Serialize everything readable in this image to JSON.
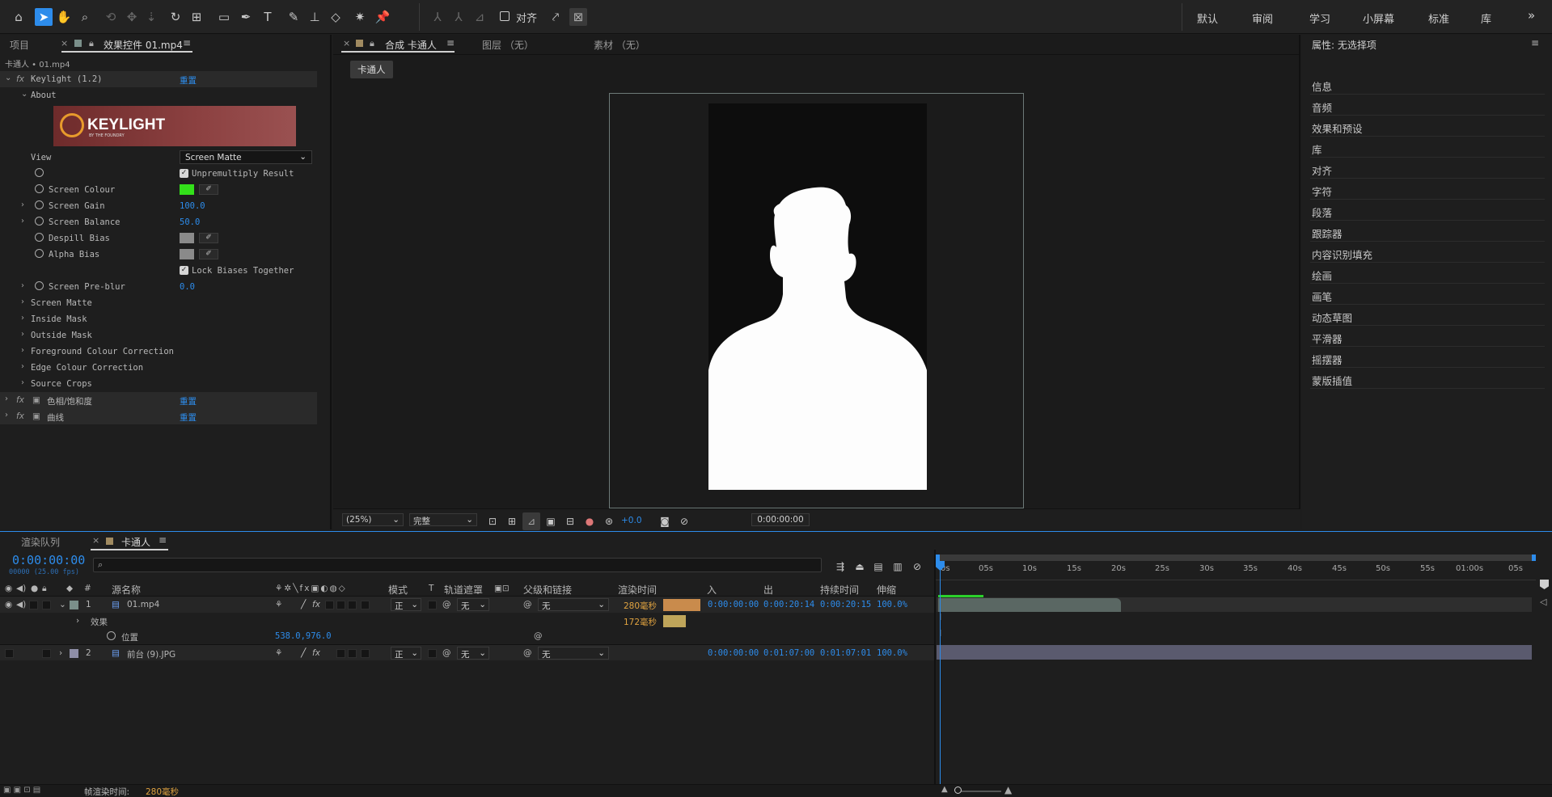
{
  "toolbar": {
    "snap_label": "对齐",
    "workspaces": [
      "默认",
      "审阅",
      "学习",
      "小屏幕",
      "标准",
      "库"
    ],
    "more": "»",
    "colors": {
      "accent": "#2d8ceb"
    }
  },
  "left_tabs": {
    "project": "项目",
    "effects": "效果控件 01.mp4",
    "breadcrumb": "卡通人 • 01.mp4"
  },
  "effects": {
    "keylight_name": "Keylight (1.2)",
    "reset": "重置",
    "about": "About",
    "logo_text": "KEYLIGHT",
    "logo_sub": "BY THE FOUNDRY",
    "view_label": "View",
    "view_value": "Screen Matte",
    "unpremultiply": "Unpremultiply Result",
    "screen_colour": "Screen Colour",
    "screen_colour_hex": "#33e01a",
    "screen_gain": "Screen Gain",
    "screen_gain_value": "100.0",
    "screen_balance": "Screen Balance",
    "screen_balance_value": "50.0",
    "despill_bias": "Despill Bias",
    "alpha_bias": "Alpha Bias",
    "lock_biases": "Lock Biases Together",
    "screen_preblur": "Screen Pre-blur",
    "screen_preblur_value": "0.0",
    "groups": [
      "Screen Matte",
      "Inside Mask",
      "Outside Mask",
      "Foreground Colour Correction",
      "Edge Colour Correction",
      "Source Crops"
    ],
    "hue_sat": "色相/饱和度",
    "curves": "曲线"
  },
  "comp": {
    "tab_comp": "合成 卡通人",
    "tab_layer": "图层 （无）",
    "tab_footage": "素材 （无）",
    "comp_button": "卡通人",
    "zoom": "(25%)",
    "quality": "完整",
    "exposure": "+0.0",
    "timecode": "0:00:00:00"
  },
  "right_panel": {
    "title": "属性: 无选择项",
    "items": [
      "信息",
      "音频",
      "效果和预设",
      "库",
      "对齐",
      "字符",
      "段落",
      "跟踪器",
      "内容识别填充",
      "绘画",
      "画笔",
      "动态草图",
      "平滑器",
      "摇摆器",
      "蒙版插值"
    ]
  },
  "timeline": {
    "tab_render": "渲染队列",
    "tab_comp": "卡通人",
    "timecode": "0:00:00:00",
    "frames": "00000 (25.00 fps)",
    "search_placeholder": "",
    "headers": {
      "num": "#",
      "source": "源名称",
      "mode": "模式",
      "t": "T",
      "track_matte": "轨道遮罩",
      "parent": "父级和链接",
      "render_time": "渲染时间",
      "in": "入",
      "out": "出",
      "duration": "持续时间",
      "stretch": "伸缩"
    },
    "layers": [
      {
        "num": "1",
        "name": "01.mp4",
        "mode": "正",
        "matte": "无",
        "parent": "无",
        "render": "280毫秒",
        "in": "0:00:00:00",
        "out": "0:00:20:14",
        "dur": "0:00:20:15",
        "stretch": "100.0%"
      },
      {
        "num": "2",
        "name": "前台 (9).JPG",
        "mode": "正",
        "matte": "无",
        "parent": "无",
        "render": "",
        "in": "0:00:00:00",
        "out": "0:01:07:00",
        "dur": "0:01:07:01",
        "stretch": "100.0%"
      }
    ],
    "effects_row": "效果",
    "effects_render": "172毫秒",
    "position_label": "位置",
    "position_value": "538.0,976.0",
    "ruler": [
      "0s",
      "05s",
      "10s",
      "15s",
      "20s",
      "25s",
      "30s",
      "35s",
      "40s",
      "45s",
      "50s",
      "55s",
      "01:00s",
      "05s"
    ],
    "footer_label": "帧渲染时间:",
    "footer_value": "280毫秒"
  }
}
